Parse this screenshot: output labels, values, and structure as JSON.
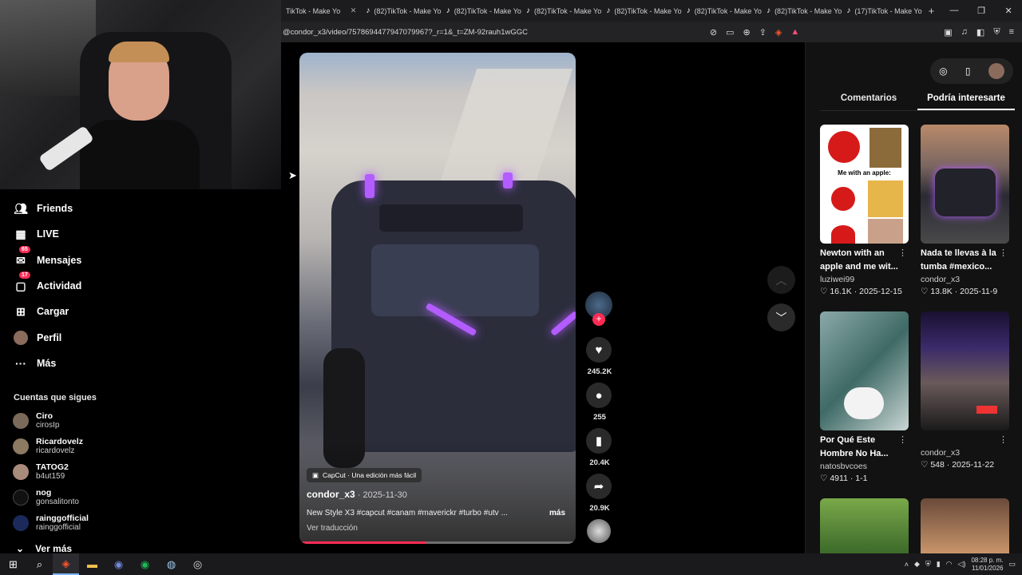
{
  "browser": {
    "tabs": [
      {
        "label": "TikTok - Make Yo"
      },
      {
        "label": "(82)TikTok - Make Yo"
      },
      {
        "label": "(82)TikTok - Make Yo"
      },
      {
        "label": "(82)TikTok - Make Yo"
      },
      {
        "label": "(82)TikTok - Make Yo"
      },
      {
        "label": "(82)TikTok - Make Yo"
      },
      {
        "label": "(82)TikTok - Make Yo"
      },
      {
        "label": "(17)TikTok - Make Yo"
      }
    ],
    "url": "@condor_x3/video/7578694477947079967?_r=1&_t=ZM-92rauh1wGGC"
  },
  "sidebar": {
    "nav": [
      {
        "label": "Friends",
        "icon": "friends-icon"
      },
      {
        "label": "LIVE",
        "icon": "live-icon"
      },
      {
        "label": "Mensajes",
        "icon": "messages-icon",
        "badge": "65"
      },
      {
        "label": "Actividad",
        "icon": "activity-icon",
        "badge": "17"
      },
      {
        "label": "Cargar",
        "icon": "upload-icon"
      },
      {
        "label": "Perfil",
        "icon": "profile-icon"
      },
      {
        "label": "Más",
        "icon": "more-icon"
      }
    ],
    "following_title": "Cuentas que sigues",
    "following": [
      {
        "name": "Ciro",
        "handle": "cirosIp"
      },
      {
        "name": "Ricardovelz",
        "handle": "ricardovelz"
      },
      {
        "name": "TATOG2",
        "handle": "b4ut159"
      },
      {
        "name": "nog",
        "handle": "gonsalitonto"
      },
      {
        "name": "rainggofficial",
        "handle": "rainggofficial"
      }
    ],
    "see_more": "Ver más"
  },
  "video": {
    "capcut": "CapCut · Una edición más fácil",
    "author": "condor_x3",
    "date": " · 2025-11-30",
    "description": "New Style X3 #capcut #canam #maverickr #turbo #utv ...",
    "more": "más",
    "translate": "Ver traducción",
    "progress": 0.46
  },
  "actions": {
    "likes": "245.2K",
    "comments": "255",
    "saves": "20.4K",
    "shares": "20.9K"
  },
  "right_panel": {
    "tabs": [
      "Comentarios",
      "Podría interesarte"
    ],
    "meme_text": "Me with an apple:",
    "cards": [
      {
        "title": "Newton with an apple and me wit...",
        "author": "luziwei99",
        "likes": "16.1K",
        "date": "2025-12-15"
      },
      {
        "title": "Nada te llevas à la tumba #mexico...",
        "author": "condor_x3",
        "likes": "13.8K",
        "date": "2025-11-9"
      },
      {
        "title": "Por Qué Este Hombre No Ha...",
        "author": "natosbvcoes",
        "likes": "4911",
        "date": "1-1"
      },
      {
        "title": "",
        "author": "condor_x3",
        "likes": "548",
        "date": "2025-11-22"
      }
    ]
  },
  "taskbar": {
    "time": "08:28 p. m.",
    "date": "11/01/2026"
  },
  "colors": {
    "accent": "#fe2c55",
    "neon": "#b35cff"
  }
}
